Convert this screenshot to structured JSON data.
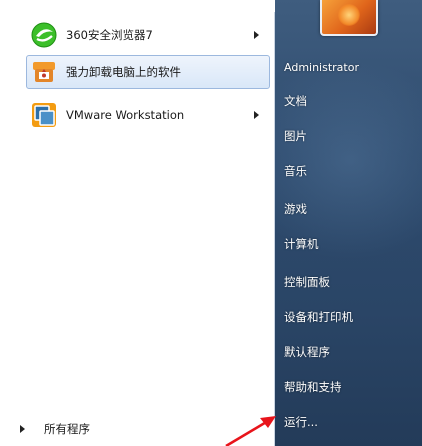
{
  "start_menu": {
    "pinned_programs": [
      {
        "label": "360安全浏览器7",
        "icon": "360-browser-icon",
        "has_submenu": true
      },
      {
        "label": "强力卸载电脑上的软件",
        "icon": "uninstaller-icon",
        "has_submenu": false,
        "selected": true
      },
      {
        "label": "VMware Workstation",
        "icon": "vmware-icon",
        "has_submenu": true
      }
    ],
    "all_programs_label": "所有程序",
    "user_name": "Administrator",
    "right_links": [
      "文档",
      "图片",
      "音乐",
      "游戏",
      "计算机",
      "控制面板",
      "设备和打印机",
      "默认程序",
      "帮助和支持",
      "运行..."
    ]
  },
  "colors": {
    "right_pane": "#2e4b6e",
    "selection": "#d9e7f8",
    "annotation_arrow": "#e8141b"
  }
}
